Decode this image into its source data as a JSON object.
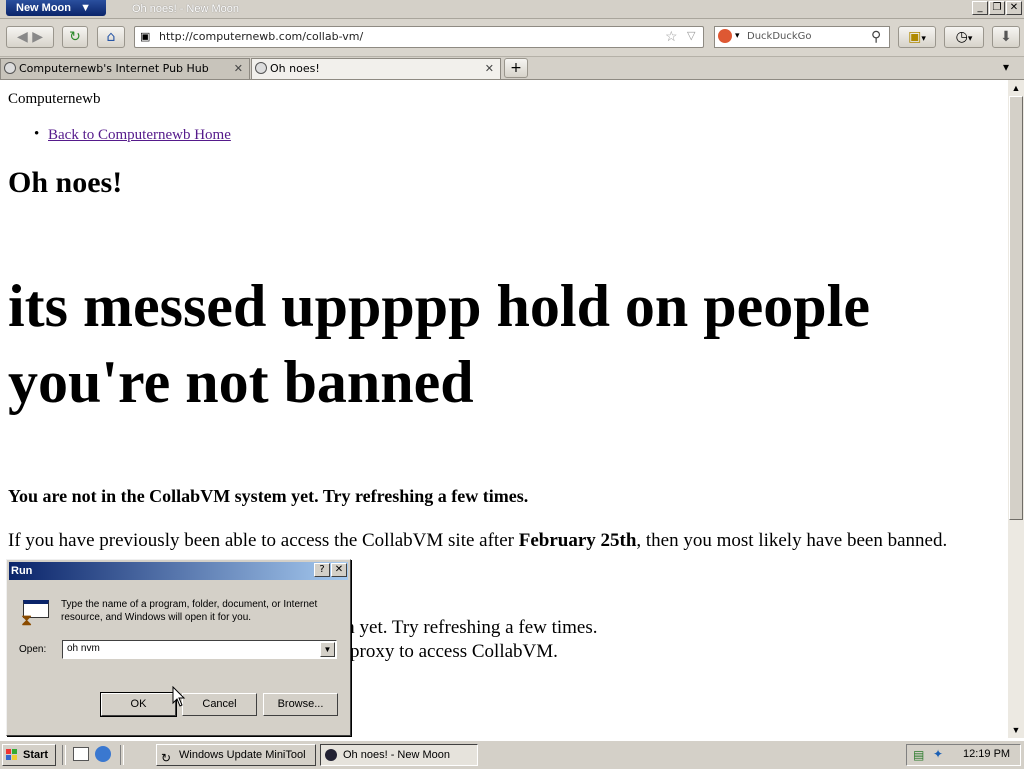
{
  "window": {
    "app_button": "New Moon",
    "title": "Oh noes! - New Moon"
  },
  "nav": {
    "url": "http://computernewb.com/collab-vm/",
    "search_engine": "DuckDuckGo"
  },
  "tabs": [
    {
      "label": "Computernewb's Internet Pub Hub",
      "active": false
    },
    {
      "label": "Oh noes!",
      "active": true
    }
  ],
  "page": {
    "site_name": "Computernewb",
    "home_link": "Back to Computernewb Home",
    "heading": "Oh noes!",
    "big_line1": "its messed uppppp hold on people",
    "big_line2": "you're not banned",
    "bold_notice": "You are not in the CollabVM system yet. Try refreshing a few times.",
    "para_prefix": "If you have previously been able to access the CollabVM site after ",
    "para_bold": "February 25th",
    "para_suffix": ", then you most likely have been banned.",
    "partial1": "m yet. Try refreshing a few times.",
    "partial2": "proxy to access CollabVM."
  },
  "run_dialog": {
    "title": "Run",
    "help": "?",
    "close": "✕",
    "description": "Type the name of a program, folder, document, or Internet resource, and Windows will open it for you.",
    "open_label": "Open:",
    "open_value": "oh nvm",
    "ok": "OK",
    "cancel": "Cancel",
    "browse": "Browse..."
  },
  "taskbar": {
    "start": "Start",
    "items": [
      {
        "label": "Windows Update MiniTool"
      },
      {
        "label": "Oh noes! - New Moon"
      }
    ],
    "clock": "12:19 PM"
  }
}
